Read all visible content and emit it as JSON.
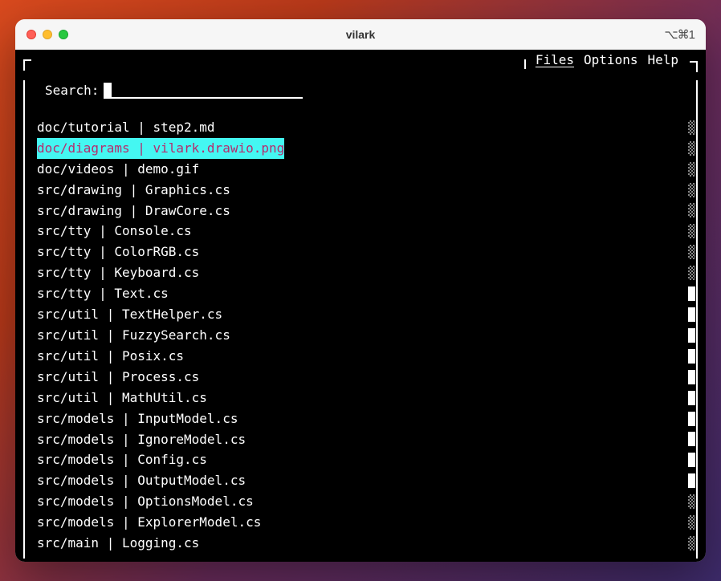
{
  "window": {
    "title": "vilark",
    "shortcut": "⌥⌘1"
  },
  "menu": {
    "items": [
      {
        "label": "Files",
        "active": true
      },
      {
        "label": "Options",
        "active": false
      },
      {
        "label": "Help",
        "active": false
      }
    ]
  },
  "search": {
    "label": "Search:",
    "value": ""
  },
  "files": [
    {
      "dir": "doc/tutorial",
      "name": "step2.md",
      "selected": false,
      "bar": "shade"
    },
    {
      "dir": "doc/diagrams",
      "name": "vilark.drawio.png",
      "selected": true,
      "bar": "shade"
    },
    {
      "dir": "doc/videos",
      "name": "demo.gif",
      "selected": false,
      "bar": "shade"
    },
    {
      "dir": "src/drawing",
      "name": "Graphics.cs",
      "selected": false,
      "bar": "shade"
    },
    {
      "dir": "src/drawing",
      "name": "DrawCore.cs",
      "selected": false,
      "bar": "shade"
    },
    {
      "dir": "src/tty",
      "name": "Console.cs",
      "selected": false,
      "bar": "shade"
    },
    {
      "dir": "src/tty",
      "name": "ColorRGB.cs",
      "selected": false,
      "bar": "shade"
    },
    {
      "dir": "src/tty",
      "name": "Keyboard.cs",
      "selected": false,
      "bar": "shade"
    },
    {
      "dir": "src/tty",
      "name": "Text.cs",
      "selected": false,
      "bar": "solid"
    },
    {
      "dir": "src/util",
      "name": "TextHelper.cs",
      "selected": false,
      "bar": "solid"
    },
    {
      "dir": "src/util",
      "name": "FuzzySearch.cs",
      "selected": false,
      "bar": "solid"
    },
    {
      "dir": "src/util",
      "name": "Posix.cs",
      "selected": false,
      "bar": "solid"
    },
    {
      "dir": "src/util",
      "name": "Process.cs",
      "selected": false,
      "bar": "solid"
    },
    {
      "dir": "src/util",
      "name": "MathUtil.cs",
      "selected": false,
      "bar": "solid"
    },
    {
      "dir": "src/models",
      "name": "InputModel.cs",
      "selected": false,
      "bar": "solid"
    },
    {
      "dir": "src/models",
      "name": "IgnoreModel.cs",
      "selected": false,
      "bar": "solid"
    },
    {
      "dir": "src/models",
      "name": "Config.cs",
      "selected": false,
      "bar": "solid"
    },
    {
      "dir": "src/models",
      "name": "OutputModel.cs",
      "selected": false,
      "bar": "solid"
    },
    {
      "dir": "src/models",
      "name": "OptionsModel.cs",
      "selected": false,
      "bar": "shade"
    },
    {
      "dir": "src/models",
      "name": "ExplorerModel.cs",
      "selected": false,
      "bar": "shade"
    },
    {
      "dir": "src/main",
      "name": "Logging.cs",
      "selected": false,
      "bar": "shade"
    }
  ]
}
